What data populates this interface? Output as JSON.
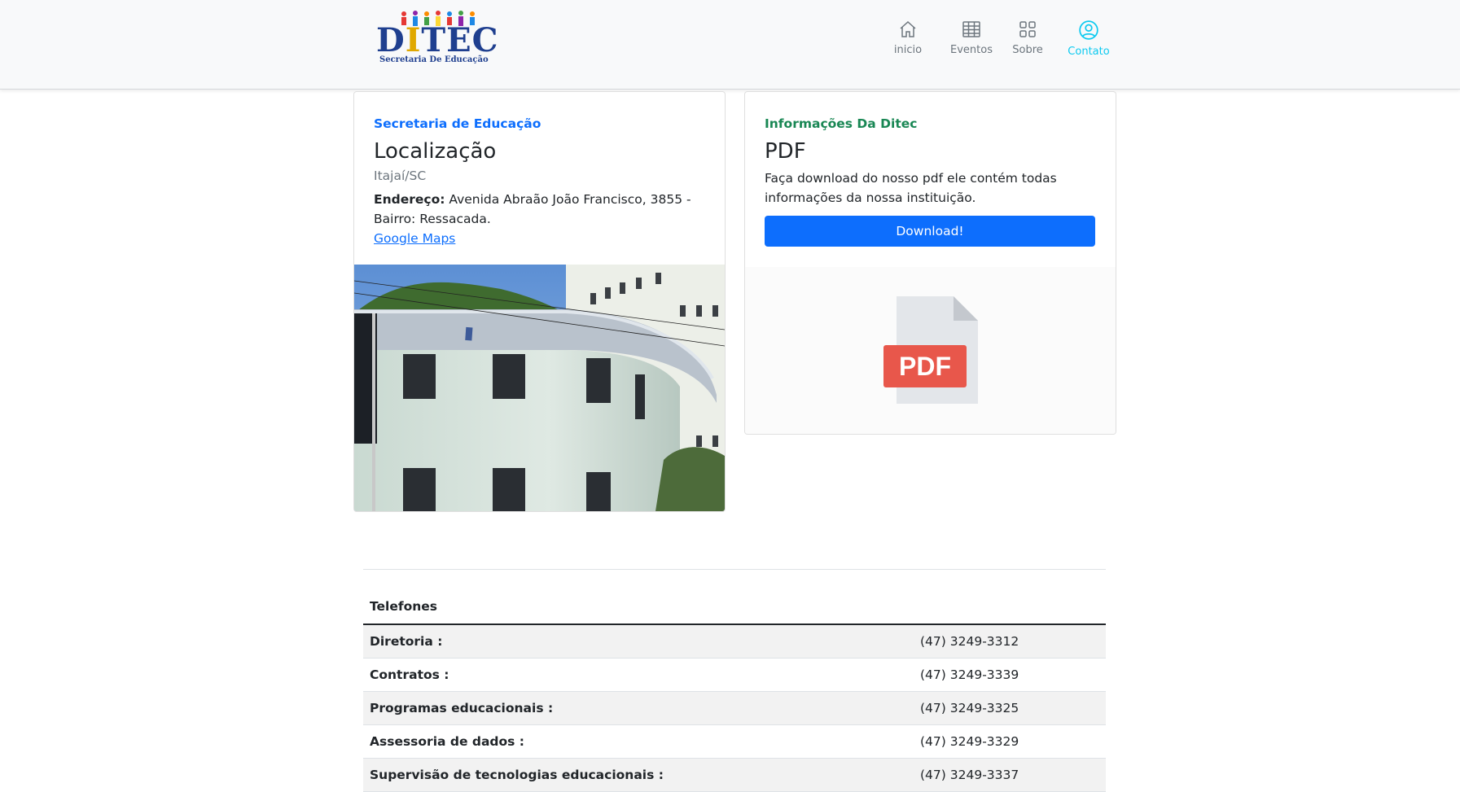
{
  "header": {
    "logo_text_pre": "D",
    "logo_text_i": "I",
    "logo_text_post": "TEC",
    "logo_subtitle": "Secretaria De Educação",
    "nav": [
      {
        "label": "inicio",
        "icon": "home-icon"
      },
      {
        "label": "Eventos",
        "icon": "table-icon"
      },
      {
        "label": "Sobre",
        "icon": "grid-icon"
      },
      {
        "label": "Contato",
        "icon": "person-circle-icon",
        "active": true
      }
    ],
    "active_color": "#0dcaf0"
  },
  "location_card": {
    "subtitle": "Secretaria de Educação",
    "title": "Localização",
    "city": "Itajaí/SC",
    "address_label": "Endereço:",
    "address": "Avenida Abraão João Francisco, 3855 - Bairro: Ressacada.",
    "maps_link": "Google Maps"
  },
  "pdf_card": {
    "subtitle": "Informações Da Ditec",
    "title": "PDF",
    "description": "Faça download do nosso pdf ele contém todas informações da nossa instituição.",
    "button_label": "Download!",
    "icon_label": "PDF"
  },
  "phones": {
    "header": "Telefones",
    "rows": [
      {
        "label": "Diretoria :",
        "number": "(47) 3249-3312"
      },
      {
        "label": "Contratos :",
        "number": "(47) 3249-3339"
      },
      {
        "label": "Programas educacionais :",
        "number": "(47) 3249-3325"
      },
      {
        "label": "Assessoria de dados :",
        "number": "(47) 3249-3329"
      },
      {
        "label": "Supervisão de tecnologias educacionais :",
        "number": "(47) 3249-3337"
      }
    ]
  },
  "colors": {
    "primary": "#0d6efd",
    "success": "#198754",
    "info": "#0dcaf0",
    "pdf_red": "#e8574b"
  }
}
